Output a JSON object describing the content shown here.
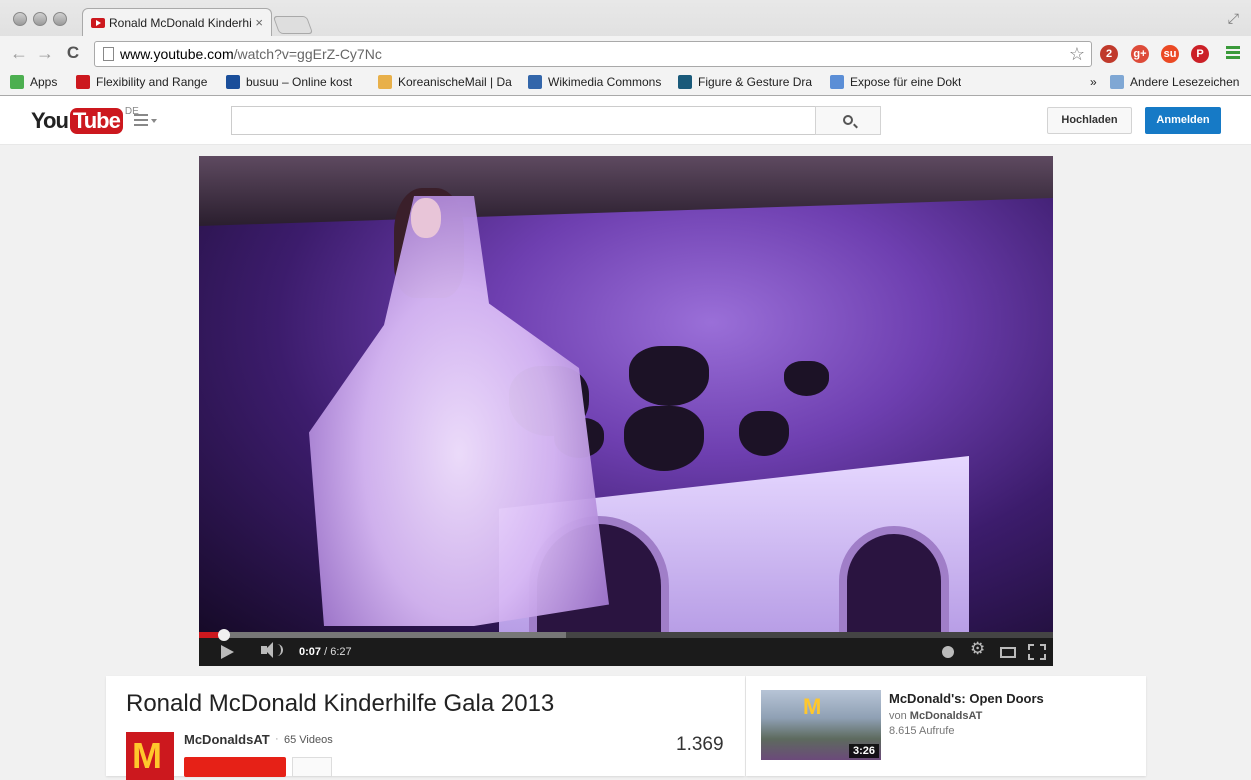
{
  "browser": {
    "tab_title": "Ronald McDonald Kinderhi",
    "tab_close": "×",
    "url_host": "www.youtube.com",
    "url_path": "/watch?v=ggErZ-Cy7Nc",
    "back_glyph": "←",
    "forward_glyph": "→",
    "reload_glyph": "C",
    "extensions": [
      {
        "name": "adblock-icon",
        "color": "#c0392b",
        "label": "2"
      },
      {
        "name": "google-plus-icon",
        "color": "#dd4b39",
        "label": "g+"
      },
      {
        "name": "stumbleupon-icon",
        "color": "#eb4924",
        "label": "su"
      },
      {
        "name": "pinterest-icon",
        "color": "#cb2027",
        "label": "P"
      }
    ],
    "bookmarks": [
      {
        "label": "Apps",
        "color": "#4caf50"
      },
      {
        "label": "Flexibility and Range",
        "color": "#cc181e"
      },
      {
        "label": "busuu – Online kost",
        "color": "#1a4e9a"
      },
      {
        "label": "KoreanischeMail | Da",
        "color": "#e8b04a"
      },
      {
        "label": "Wikimedia Commons",
        "color": "#3366aa"
      },
      {
        "label": "Figure & Gesture Dra",
        "color": "#1a5a7a"
      },
      {
        "label": "Expose für eine Dokt",
        "color": "#5b8ed6"
      }
    ],
    "bookmarks_overflow": "»",
    "other_bookmarks": "Andere Lesezeichen"
  },
  "youtube": {
    "logo_you": "You",
    "logo_tube": "Tube",
    "region": "DE",
    "upload_label": "Hochladen",
    "signin_label": "Anmelden",
    "brand_color": "#cc181e",
    "accent_color": "#167ac6"
  },
  "player": {
    "current_time": "0:07",
    "duration": " / 6:27",
    "progress_played_pct": 2.9,
    "progress_buffered_pct": 43
  },
  "video": {
    "title": "Ronald McDonald Kinderhilfe Gala 2013",
    "channel_name": "McDonaldsAT",
    "separator": "·",
    "video_count": "65 Videos",
    "views": "1.369",
    "channel_logo_glyph": "M"
  },
  "related": {
    "title": "McDonald's: Open Doors",
    "by_prefix": "von ",
    "by_channel": "McDonaldsAT",
    "views": "8.615 Aufrufe",
    "duration": "3:26",
    "thumb_glyph": "M"
  }
}
